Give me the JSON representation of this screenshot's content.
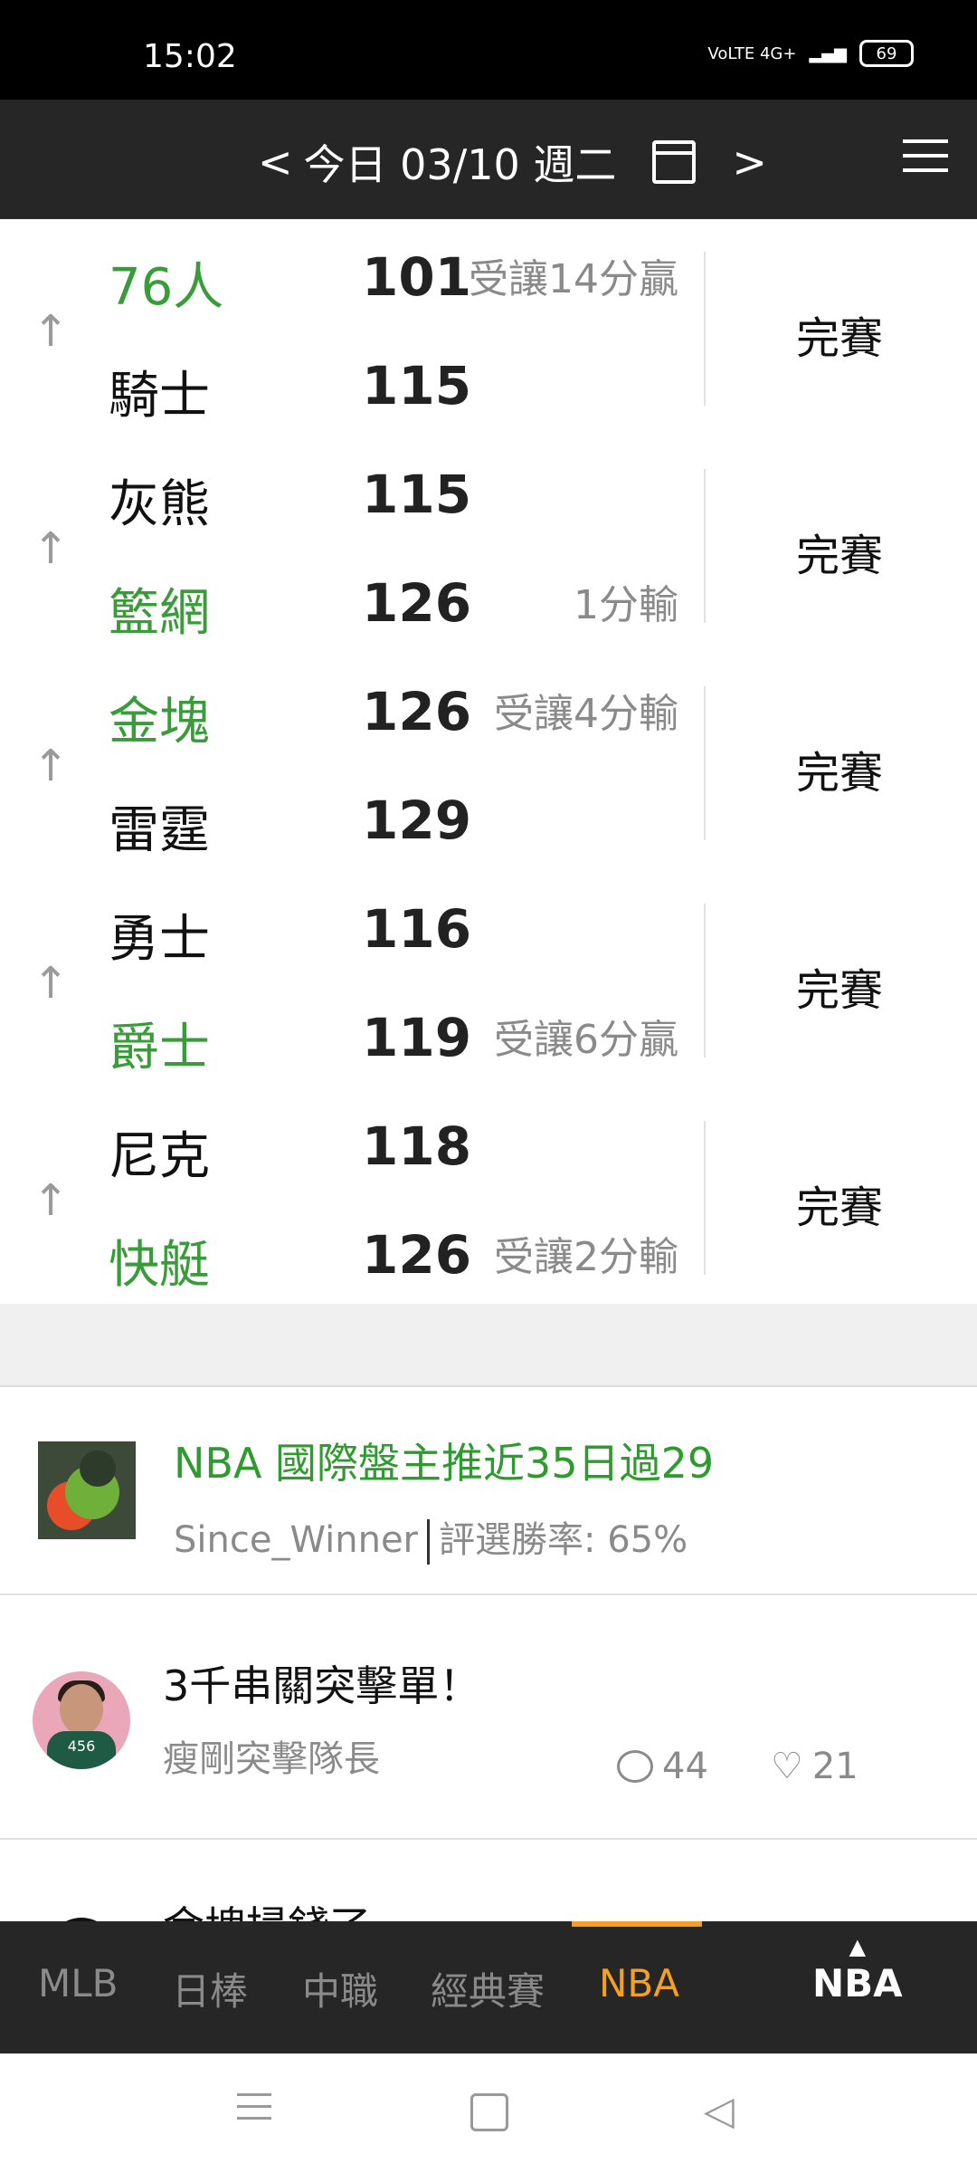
{
  "status_bar": {
    "time": "15:02",
    "network": "VoLTE 4G+",
    "battery": "69"
  },
  "header": {
    "prev": "<",
    "date_label": "今日 03/10 週二",
    "next": ">",
    "calendar_icon": "calendar-icon",
    "menu_icon": "hamburger-icon"
  },
  "colors": {
    "win_green": "#3a9b3a",
    "header_bg": "#262626",
    "accent_orange": "#f5a024"
  },
  "games": [
    {
      "away": {
        "name": "76人",
        "score": "101",
        "spread": "受讓14分贏",
        "highlight": true
      },
      "home": {
        "name": "騎士",
        "score": "115",
        "spread": "",
        "highlight": false
      },
      "status": "完賽"
    },
    {
      "away": {
        "name": "灰熊",
        "score": "115",
        "spread": "",
        "highlight": false
      },
      "home": {
        "name": "籃網",
        "score": "126",
        "spread": "1分輸",
        "highlight": true
      },
      "status": "完賽"
    },
    {
      "away": {
        "name": "金塊",
        "score": "126",
        "spread": "受讓4分輸",
        "highlight": true
      },
      "home": {
        "name": "雷霆",
        "score": "129",
        "spread": "",
        "highlight": false
      },
      "status": "完賽"
    },
    {
      "away": {
        "name": "勇士",
        "score": "116",
        "spread": "",
        "highlight": false
      },
      "home": {
        "name": "爵士",
        "score": "119",
        "spread": "受讓6分贏",
        "highlight": true
      },
      "status": "完賽"
    },
    {
      "away": {
        "name": "尼克",
        "score": "118",
        "spread": "",
        "highlight": false
      },
      "home": {
        "name": "快艇",
        "score": "126",
        "spread": "受讓2分輸",
        "highlight": true
      },
      "status": "完賽"
    }
  ],
  "posts": [
    {
      "title": "NBA 國際盤主推近35日過29",
      "author": "Since_Winner",
      "rate": "評選勝率: 65%"
    },
    {
      "title": "3千串關突擊單！",
      "author": "瘦剛突擊隊長",
      "comments": "44",
      "likes": "21"
    },
    {
      "title_partial": "金塊掃錢了"
    }
  ],
  "tabs": [
    {
      "label": "MLB",
      "active": false
    },
    {
      "label": "日棒",
      "active": false
    },
    {
      "label": "中職",
      "active": false
    },
    {
      "label": "經典賽",
      "active": false
    },
    {
      "label": "NBA",
      "active": true
    }
  ],
  "league_picker": {
    "label": "NBA"
  }
}
